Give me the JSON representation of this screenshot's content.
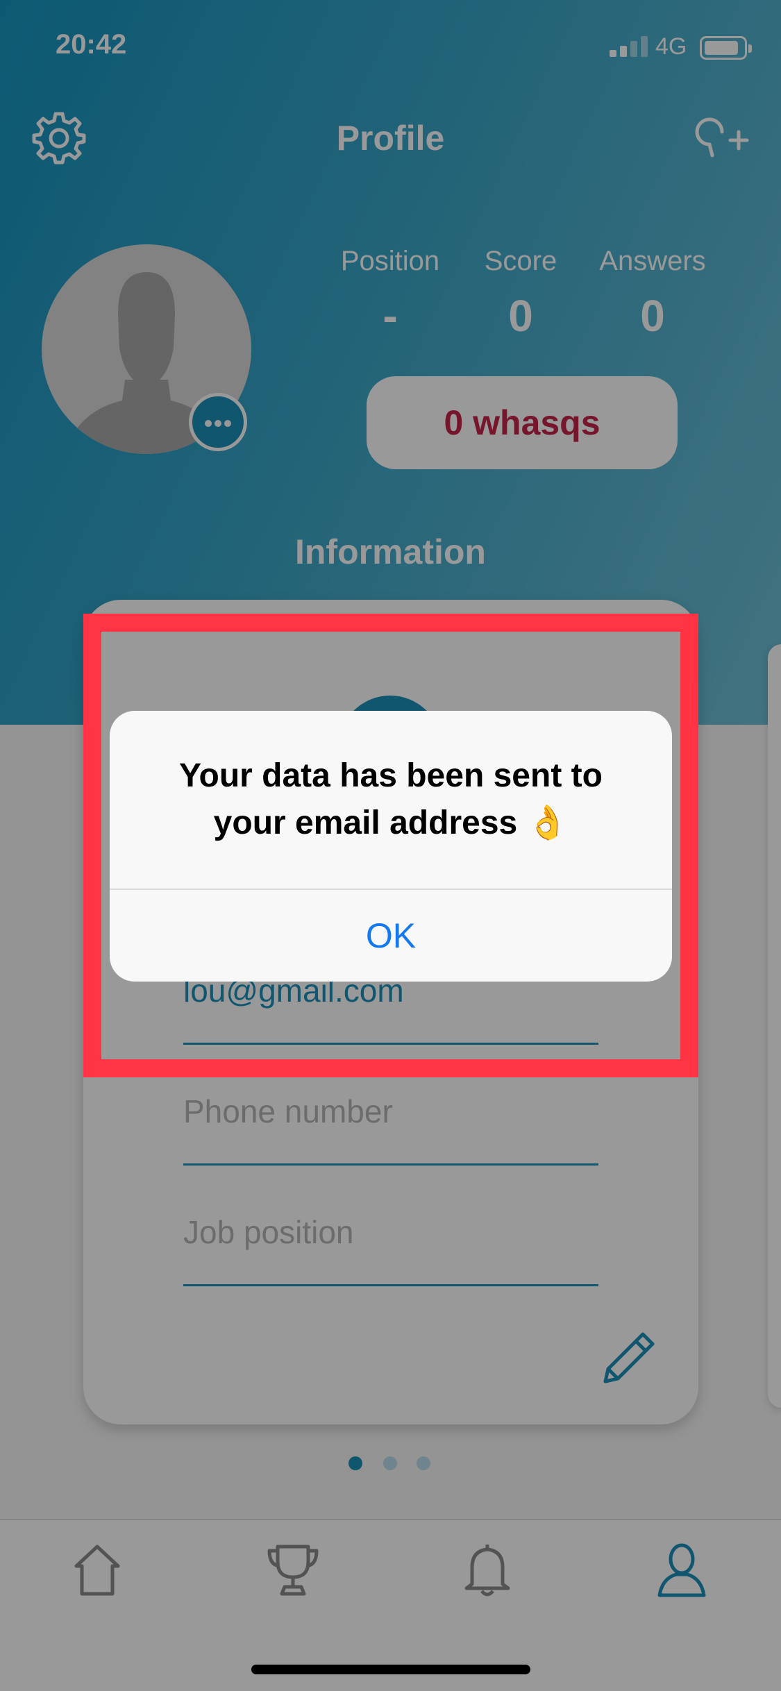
{
  "status_bar": {
    "time": "20:42",
    "network": "4G"
  },
  "nav": {
    "title": "Profile",
    "left_icon": "gear-icon",
    "right_icon": "add-search-icon"
  },
  "profile": {
    "avatar_icon": "avatar-placeholder-icon",
    "more_icon": "more-dots-icon",
    "stats": [
      {
        "label": "Position",
        "value": "-"
      },
      {
        "label": "Score",
        "value": "0"
      },
      {
        "label": "Answers",
        "value": "0"
      }
    ],
    "whasqs_label": "0 whasqs"
  },
  "section": {
    "title": "Information"
  },
  "card": {
    "email_value": "lou@gmail.com",
    "phone_placeholder": "Phone number",
    "job_placeholder": "Job position",
    "edit_icon": "pencil-icon",
    "page_count": 3,
    "active_page": 1
  },
  "tabbar": {
    "items": [
      {
        "icon": "home-icon",
        "active": false
      },
      {
        "icon": "trophy-icon",
        "active": false
      },
      {
        "icon": "bell-icon",
        "active": false
      },
      {
        "icon": "user-icon",
        "active": true
      }
    ]
  },
  "alert": {
    "title_line1": "Your data has been sent to",
    "title_line2": "your email address 👌",
    "ok_label": "OK"
  },
  "colors": {
    "accent": "#1c8fb8",
    "whasqs": "#c4254a",
    "highlight": "#ff3344",
    "alert_button": "#1479f0"
  }
}
